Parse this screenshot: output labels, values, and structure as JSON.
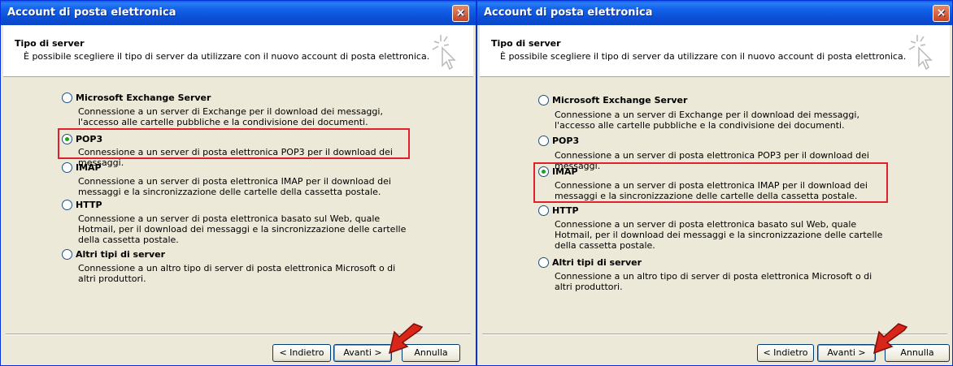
{
  "windows": [
    {
      "title": "Account di posta elettronica",
      "close_label": "×",
      "header": {
        "title": "Tipo di server",
        "subtitle": "È possibile scegliere il tipo di server da utilizzare con il nuovo account di posta elettronica."
      },
      "options": [
        {
          "label": "Microsoft Exchange Server",
          "description": "Connessione a un server di Exchange per il download dei messaggi, l'accesso alle cartelle pubbliche e la condivisione dei documenti.",
          "selected": false
        },
        {
          "label": "POP3",
          "description": "Connessione a un server di posta elettronica POP3 per il download dei messaggi.",
          "selected": true
        },
        {
          "label": "IMAP",
          "description": "Connessione a un server di posta elettronica IMAP per il download dei messaggi e la sincronizzazione delle cartelle della cassetta postale.",
          "selected": false
        },
        {
          "label": "HTTP",
          "description": "Connessione a un server di posta elettronica basato sul Web, quale Hotmail, per il download dei messaggi e la sincronizzazione delle cartelle della cassetta postale.",
          "selected": false
        },
        {
          "label": "Altri tipi di server",
          "description": "Connessione a un altro tipo di server di posta elettronica Microsoft o di altri produttori.",
          "selected": false
        }
      ],
      "buttons": {
        "back": "< Indietro",
        "next": "Avanti >",
        "cancel": "Annulla"
      }
    },
    {
      "title": "Account di posta elettronica",
      "close_label": "×",
      "header": {
        "title": "Tipo di server",
        "subtitle": "È possibile scegliere il tipo di server da utilizzare con il nuovo account di posta elettronica."
      },
      "options": [
        {
          "label": "Microsoft Exchange Server",
          "description": "Connessione a un server di Exchange per il download dei messaggi, l'accesso alle cartelle pubbliche e la condivisione dei documenti.",
          "selected": false
        },
        {
          "label": "POP3",
          "description": "Connessione a un server di posta elettronica POP3 per il download dei messaggi.",
          "selected": false
        },
        {
          "label": "IMAP",
          "description": "Connessione a un server di posta elettronica IMAP per il download dei messaggi e la sincronizzazione delle cartelle della cassetta postale.",
          "selected": true
        },
        {
          "label": "HTTP",
          "description": "Connessione a un server di posta elettronica basato sul Web, quale Hotmail, per il download dei messaggi e la sincronizzazione delle cartelle della cassetta postale.",
          "selected": false
        },
        {
          "label": "Altri tipi di server",
          "description": "Connessione a un altro tipo di server di posta elettronica Microsoft o di altri produttori.",
          "selected": false
        }
      ],
      "buttons": {
        "back": "< Indietro",
        "next": "Avanti >",
        "cancel": "Annulla"
      }
    }
  ],
  "colors": {
    "highlight": "#e0202a",
    "titlebar": "#0a5ee9",
    "arrow": "#d8261a"
  }
}
